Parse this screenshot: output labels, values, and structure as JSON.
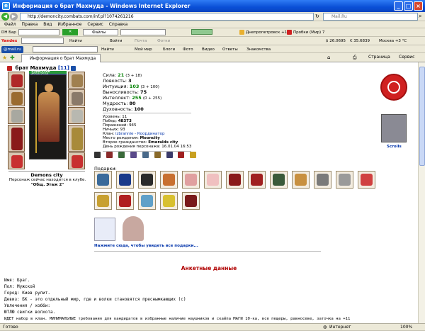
{
  "window": {
    "title": "Информация о брат Махмуда - Windows Internet Explorer"
  },
  "address": {
    "url": "http://demoncity.combats.com/inf.pl?1074261216",
    "search_placeholder": "Mail.Ru"
  },
  "menu": [
    "Файл",
    "Правка",
    "Вид",
    "Избранное",
    "Сервис",
    "Справка"
  ],
  "toolbar1": {
    "brand": "DH Бар",
    "search_btn": "Найти",
    "files": "Файлы",
    "go": "Войти",
    "mail": "Почта",
    "photo": "Фотки",
    "weather": "Днепропетровск +12",
    "traffic": "Пробки (Мир) 7"
  },
  "toolbar2": {
    "brand": "Yandex",
    "search_btn": "Найти",
    "usd": "$ 26.0695",
    "eur": "€ 35.6839",
    "weather": "Москва +3 °С"
  },
  "toolbar3": {
    "brand": "@mail.ru",
    "search_btn": "Найти",
    "items": [
      "Мой мир",
      "Блоги",
      "Фото",
      "Видео",
      "Ответы",
      "Знакомства"
    ]
  },
  "tab": {
    "label": "Информация о брат Махмуда"
  },
  "ie_cmd": {
    "page": "Страница",
    "tools": "Сервис"
  },
  "character": {
    "name": "брат Махмуда",
    "level": "[11]",
    "hp": "2588/2588",
    "mp": "4550/2550",
    "city": "Demons city",
    "location": "Персонаж сейчас находится в клубе.",
    "room": "\"Общ. Этаж 2\""
  },
  "stats": [
    {
      "label": "Сила:",
      "value": "21",
      "bonus": "(3 + 18)"
    },
    {
      "label": "Ловкость:",
      "value": "3",
      "bonus": ""
    },
    {
      "label": "Интуиция:",
      "value": "103",
      "bonus": "(3 + 100)"
    },
    {
      "label": "Выносливость:",
      "value": "75",
      "bonus": ""
    },
    {
      "label": "Интеллект:",
      "value": "255",
      "bonus": "(0 + 255)"
    },
    {
      "label": "Мудрость:",
      "value": "80",
      "bonus": ""
    },
    {
      "label": "Духовность:",
      "value": "100",
      "bonus": ""
    }
  ],
  "info": [
    {
      "label": "Уровень:",
      "value": "11"
    },
    {
      "label": "Побед:",
      "value": "48373"
    },
    {
      "label": "Поражений:",
      "value": "945"
    },
    {
      "label": "Ничьих:",
      "value": "93"
    },
    {
      "label": "Клан:",
      "value": "izbrannie - Координатор"
    },
    {
      "label": "Место рождения:",
      "value": "Mooncity"
    },
    {
      "label": "Второе гражданство:",
      "value": "Emeralds city"
    },
    {
      "label": "День рождения персонажа:",
      "value": "16.01.04 16:53"
    }
  ],
  "gifts_label": "Подарки:",
  "gifts_more": "Нажмите сюда, чтобы увидеть все подарки...",
  "clan_banner": "Scrolls",
  "section_title": "Анкетные данные",
  "profile": [
    "Имя: Брат.",
    "Пол: Мужской",
    "Город: Киев рулит.",
    "Девиз: БК - это отдельный мир, где и волки становятся преснымкающих (c)",
    "Увлечения / хобби:",
    "ЮТЛЮ свитки волхота."
  ],
  "footer_line": "ИДЕТ набор в клан. МИНИМАЛЬНЫЕ требования для кандидатов в избранные   наличие наушников и скайпа МАГИ 10-ка, все пещеры, равносеве, заточка на +11",
  "status": {
    "left": "Готово",
    "zone": "Интернет",
    "zoom": "100%"
  },
  "colors": {
    "title_bar": "#0a4fd6",
    "stat_green": "#008000",
    "section_red": "#b00000",
    "link_blue": "#0033aa"
  }
}
